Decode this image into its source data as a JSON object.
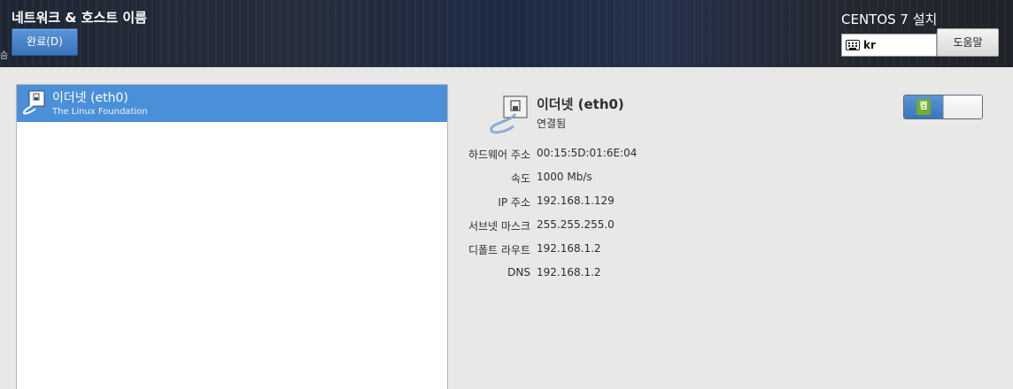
{
  "header": {
    "title": "네트워크 & 호스트 이름",
    "done_label": "완료(D)",
    "install_title": "CENTOS 7 설치",
    "keyboard_layout": "kr",
    "help_label": "도움말",
    "edge_glyph": "슴"
  },
  "device_list": {
    "items": [
      {
        "name": "이더넷 (eth0)",
        "vendor": "The Linux Foundation",
        "selected": true,
        "icon": "ethernet-icon"
      }
    ]
  },
  "detail": {
    "name": "이더넷 (eth0)",
    "status": "연결됨",
    "icon": "ethernet-icon",
    "toggle_label": "켬",
    "toggle_on": true,
    "info": [
      {
        "label": "하드웨어 주소",
        "value": "00:15:5D:01:6E:04"
      },
      {
        "label": "속도",
        "value": "1000 Mb/s"
      },
      {
        "label": "IP 주소",
        "value": "192.168.1.129"
      },
      {
        "label": "서브넷 마스크",
        "value": "255.255.255.0"
      },
      {
        "label": "디폴트 라우트",
        "value": "192.168.1.2"
      },
      {
        "label": "DNS",
        "value": "192.168.1.2"
      }
    ]
  },
  "colors": {
    "accent": "#4a90d9",
    "toggle_on_badge": "#6fae2f",
    "header_bg": "#1f2633",
    "background": "#e8e8e7"
  }
}
